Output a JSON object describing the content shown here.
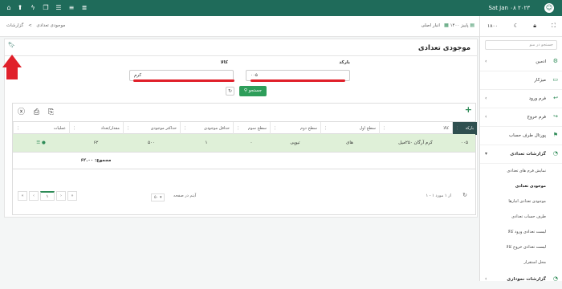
{
  "topbar": {
    "date": "Sat Jan ۰۸ ۲۰۲۳",
    "icons": [
      "home-icon",
      "upload-icon",
      "bolt-icon",
      "copy-icon",
      "list-icon",
      "filter-icon",
      "menu-icon"
    ]
  },
  "sidebar": {
    "number": "۱۸۰۰",
    "search_placeholder": "جستجو در منو",
    "items": [
      {
        "label": "ادمین"
      },
      {
        "label": "میزکار"
      },
      {
        "label": "فرم ورود"
      },
      {
        "label": "فرم خروج"
      },
      {
        "label": "پورتال طرف حساب"
      },
      {
        "label": "گزارشات تعدادی"
      }
    ],
    "subitems": [
      {
        "label": "نمایش فرم های تعدادی"
      },
      {
        "label": "موجودی تعدادی"
      },
      {
        "label": "موجودی تعدادی انبارها"
      },
      {
        "label": "طرف حساب تعدادی"
      },
      {
        "label": "لیست تعدادی ورود کالا"
      },
      {
        "label": "لیست تعدادی خروج کالا"
      },
      {
        "label": "محل استقرار"
      }
    ],
    "bottom": {
      "label": "گزارشات نموداری"
    }
  },
  "breadcrumb": {
    "root": "گزارشات",
    "sep": ">",
    "current": "موجودی تعدادی"
  },
  "context": {
    "warehouse": "انبار اصلی",
    "period": "پاییز ۱۴۰۰"
  },
  "page": {
    "title": "موجودی تعدادی"
  },
  "filters": {
    "barcode_label": "بارکد",
    "barcode_value": "۰۰۵",
    "product_label": "کالا",
    "product_value": "کرم",
    "search_button": "جستجو"
  },
  "table": {
    "headers": [
      "بارکد",
      "کالا",
      "سطح اول",
      "سطح دوم",
      "سطح سوم",
      "حداقل موجودی",
      "حداکثر موجودی",
      "مقدار/تعداد",
      "عملیات"
    ],
    "rows": [
      {
        "barcode": "۰۰۵",
        "product": "کرم آرگان ۲۵۰میل",
        "level1": "های",
        "level2": "تیوپی",
        "level3": "۰",
        "min": "۱",
        "max": "۵۰۰",
        "qty": "۶۲"
      }
    ],
    "sum": "مجموع: ۶۲.۰۰"
  },
  "pager": {
    "info": "۱ - ۱ از ۱ مورد",
    "per_page": "۵۰",
    "per_page_label": "آیتم در صفحه",
    "current_page": "۱"
  },
  "colors": {
    "primary": "#1f6b5a",
    "accent": "#2e9e5a",
    "highlight_row": "#dff0d8",
    "annotation_red": "#e0202a"
  }
}
